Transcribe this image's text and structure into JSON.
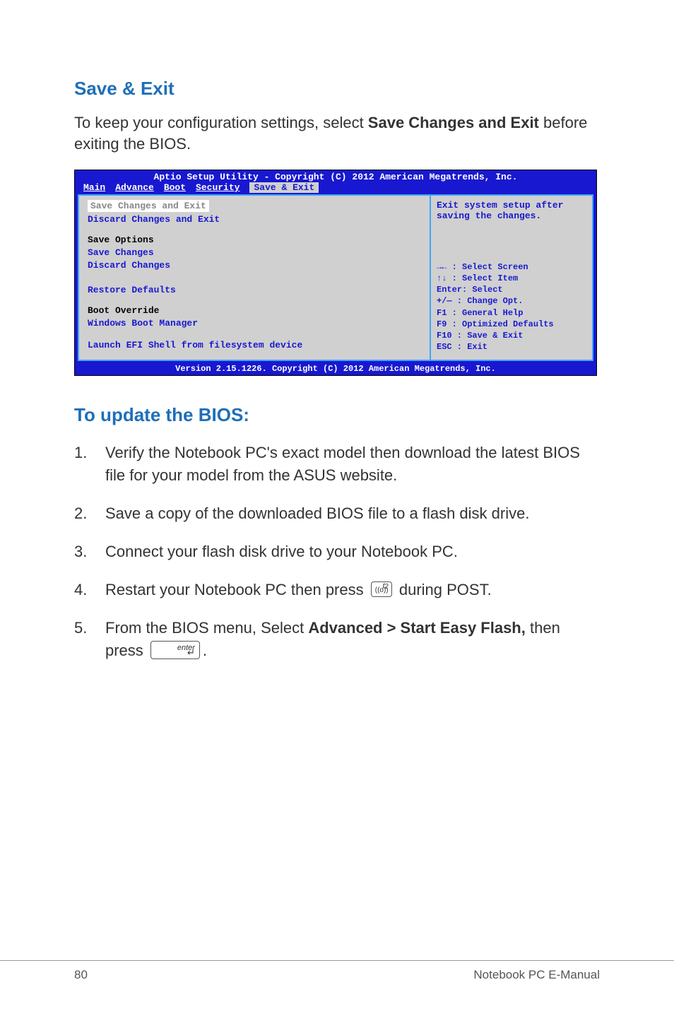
{
  "section_title": "Save & Exit",
  "intro_before": "To keep your configuration settings, select ",
  "intro_bold": "Save Changes and Exit",
  "intro_after": " before exiting the BIOS.",
  "bios": {
    "header": "Aptio Setup Utility - Copyright (C) 2012 American Megatrends, Inc.",
    "tabs": [
      "Main",
      "Advance",
      "Boot",
      "Security",
      "Save & Exit"
    ],
    "active_tab": "Save & Exit",
    "left": {
      "selected": "Save Changes and Exit",
      "item1": "Discard Changes and Exit",
      "section1": "Save Options",
      "item2": "Save Changes",
      "item3": "Discard Changes",
      "item4": "Restore Defaults",
      "section2": "Boot Override",
      "item5": "Windows Boot Manager",
      "item6": "Launch EFI Shell from filesystem device"
    },
    "right_top": "Exit system setup after saving the changes.",
    "help": [
      "→←   : Select Screen",
      "↑↓   : Select Item",
      "Enter: Select",
      "+/—  : Change Opt.",
      "F1   : General Help",
      "F9   : Optimized Defaults",
      "F10  : Save & Exit",
      "ESC  : Exit"
    ],
    "footer": "Version 2.15.1226. Copyright (C) 2012 American Megatrends, Inc."
  },
  "section2_title": "To update the BIOS:",
  "steps": {
    "s1": "Verify the Notebook PC's exact model then download the latest BIOS file for your model from the ASUS website.",
    "s2": "Save a copy of the downloaded BIOS file to a flash disk drive.",
    "s3": "Connect your flash disk drive to your Notebook PC.",
    "s4_before": "Restart your Notebook PC then press ",
    "s4_after": " during POST.",
    "s5_before": "From the BIOS menu, Select ",
    "s5_bold": "Advanced > Start Easy Flash,",
    "s5_mid": " then press ",
    "s5_after": "."
  },
  "keys": {
    "f2_sup": "f2",
    "f2_icon": "((o))",
    "enter_label": "enter",
    "enter_arrow": "↵"
  },
  "footer": {
    "page": "80",
    "label": "Notebook PC E-Manual"
  }
}
